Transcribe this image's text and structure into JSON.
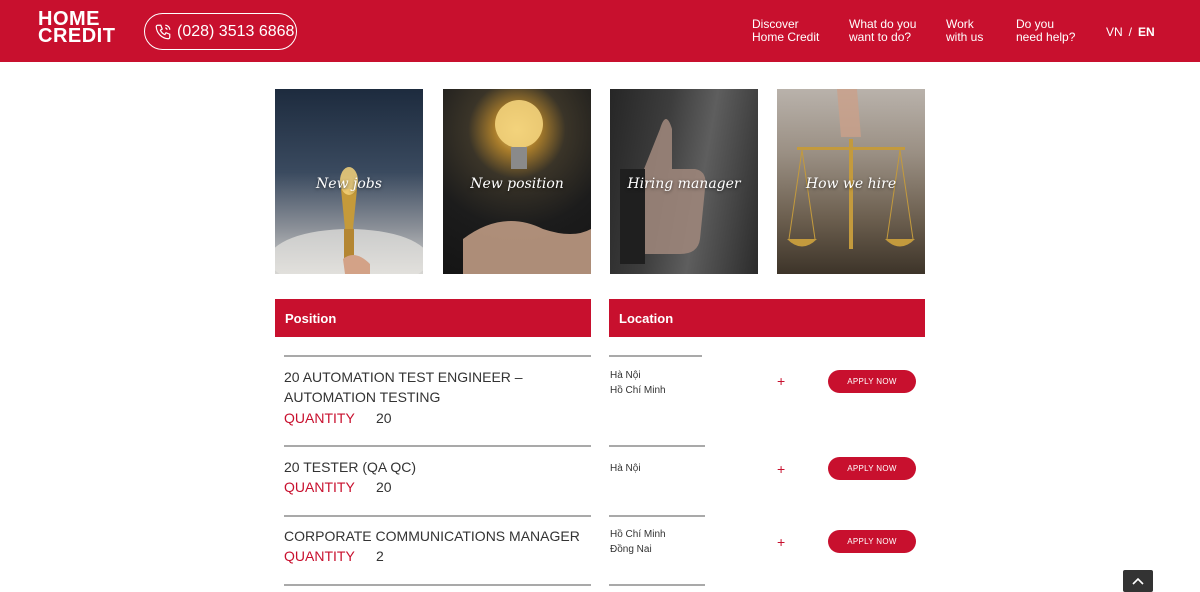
{
  "header": {
    "logo_line1": "HOME",
    "logo_line2": "CREDIT",
    "phone": "(028) 3513 6868",
    "nav": [
      {
        "line1": "Discover",
        "line2": "Home Credit"
      },
      {
        "line1": "What do you",
        "line2": "want to do?"
      },
      {
        "line1": "Work",
        "line2": "with us"
      },
      {
        "line1": "Do you",
        "line2": "need help?"
      }
    ],
    "lang_vn": "VN",
    "lang_sep": "/",
    "lang_en": "EN"
  },
  "tiles": [
    {
      "label": "New jobs",
      "icon": "torch"
    },
    {
      "label": "New position",
      "icon": "light-bulb"
    },
    {
      "label": "Hiring manager",
      "icon": "thumbs-up"
    },
    {
      "label": "How we hire",
      "icon": "scales"
    }
  ],
  "table": {
    "position_header": "Position",
    "location_header": "Location",
    "quantity_label": "QUANTITY",
    "apply_label": "APPLY NOW",
    "plus": "+",
    "rows": [
      {
        "title_line1": "20 AUTOMATION TEST ENGINEER –",
        "title_line2": "AUTOMATION TESTING",
        "quantity": "20",
        "loc1": "Hà Nội",
        "loc2": "Hồ Chí Minh"
      },
      {
        "title_line1": "20 TESTER (QA QC)",
        "title_line2": "",
        "quantity": "20",
        "loc1": "Hà Nội",
        "loc2": ""
      },
      {
        "title_line1": "CORPORATE COMMUNICATIONS MANAGER",
        "title_line2": "",
        "quantity": "2",
        "loc1": "Hồ Chí Minh",
        "loc2": "Đồng Nai"
      }
    ]
  },
  "colors": {
    "brand": "#c8102e",
    "divider": "#a9a9a9"
  }
}
